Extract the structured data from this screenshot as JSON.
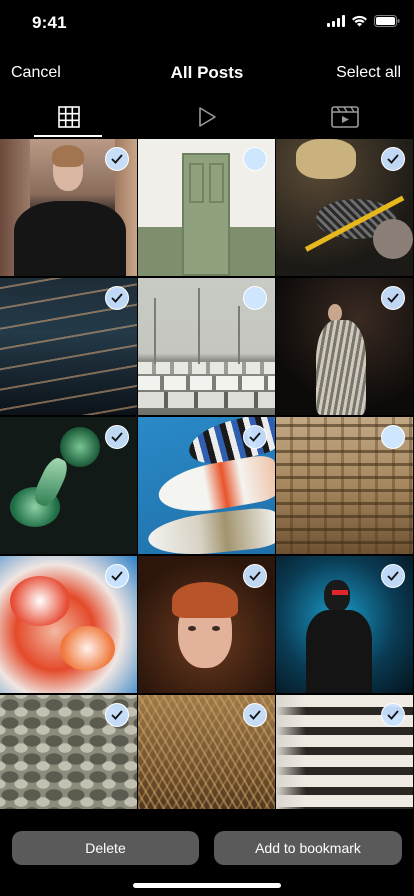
{
  "status": {
    "time": "9:41"
  },
  "nav": {
    "cancel": "Cancel",
    "title": "All Posts",
    "select_all": "Select all"
  },
  "tabs": [
    {
      "name": "grid",
      "icon": "grid-icon",
      "active": true
    },
    {
      "name": "videos",
      "icon": "play-icon",
      "active": false
    },
    {
      "name": "reels",
      "icon": "clapperboard-icon",
      "active": false
    }
  ],
  "photos": [
    {
      "subject": "woman in black coat on street",
      "checked": true
    },
    {
      "subject": "green door",
      "checked": false
    },
    {
      "subject": "hiking boots and rope",
      "checked": true
    },
    {
      "subject": "water surface at dusk",
      "checked": true
    },
    {
      "subject": "boats at marina",
      "checked": false
    },
    {
      "subject": "dancer with fringe outfit",
      "checked": true
    },
    {
      "subject": "green glass sculpture",
      "checked": true
    },
    {
      "subject": "koi fish windsocks",
      "checked": true
    },
    {
      "subject": "carved temple facade",
      "checked": false
    },
    {
      "subject": "red and white flowers",
      "checked": true
    },
    {
      "subject": "red-haired woman in fur",
      "checked": true
    },
    {
      "subject": "man in blue light",
      "checked": true
    },
    {
      "subject": "stones on wall",
      "checked": true
    },
    {
      "subject": "ferns",
      "checked": true
    },
    {
      "subject": "curved building balconies",
      "checked": true
    }
  ],
  "actions": {
    "delete": "Delete",
    "bookmark": "Add to bookmark"
  },
  "colors": {
    "background": "#000000",
    "button": "#5a5a5a",
    "check": "#cfe6ff"
  }
}
